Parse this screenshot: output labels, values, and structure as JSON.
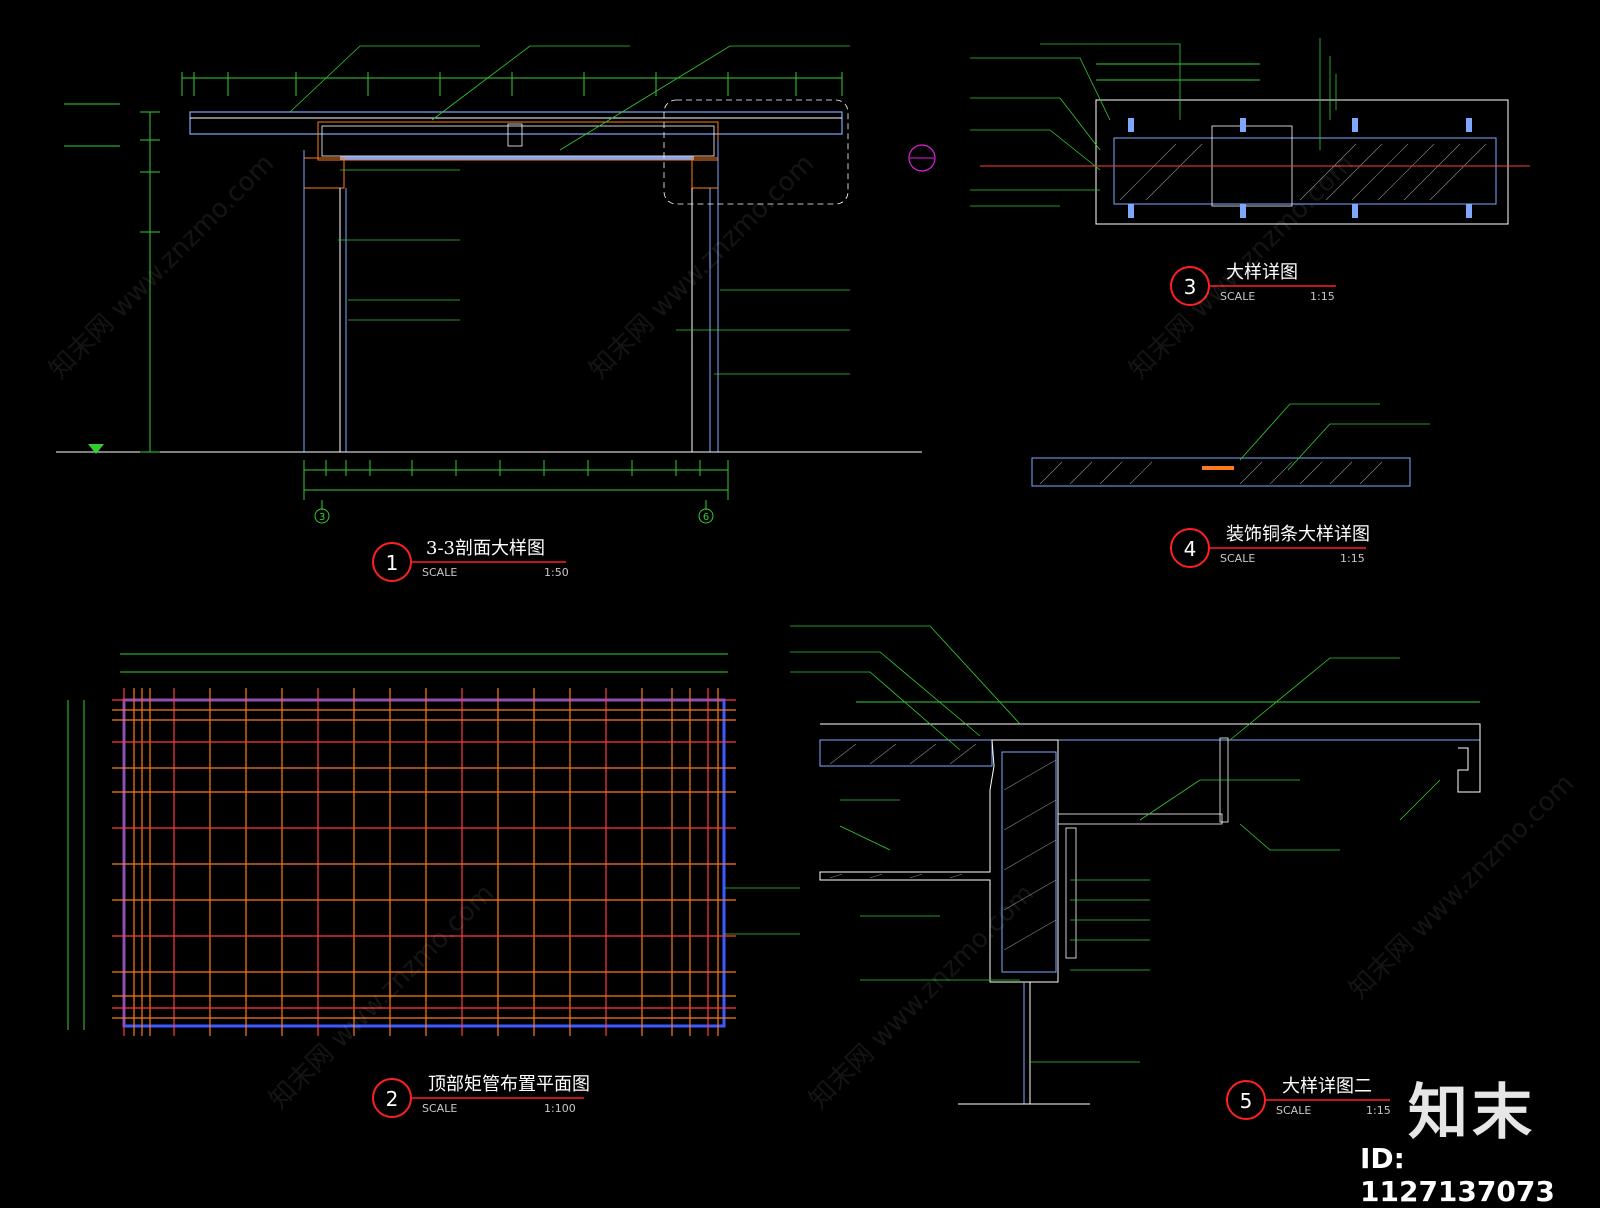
{
  "drawings": [
    {
      "number": "1",
      "title": "3-3剖面大样图",
      "scale_label": "SCALE",
      "scale": "1:50"
    },
    {
      "number": "2",
      "title": "顶部矩管布置平面图",
      "scale_label": "SCALE",
      "scale": "1:100"
    },
    {
      "number": "3",
      "title": "大样详图",
      "scale_label": "SCALE",
      "scale": "1:15"
    },
    {
      "number": "4",
      "title": "装饰铜条大样详图",
      "scale_label": "SCALE",
      "scale": "1:15"
    },
    {
      "number": "5",
      "title": "大样详图二",
      "scale_label": "SCALE",
      "scale": "1:15"
    }
  ],
  "axis_markers": [
    "3",
    "6"
  ],
  "watermark": {
    "brand": "知末",
    "id": "ID: 1127137073",
    "text": "知末网 www.znzmo.com"
  },
  "colors": {
    "background": "#000000",
    "outline": "#7fa7ff",
    "dimension": "#33cc33",
    "leader": "#33cc33",
    "grid_orange": "#ff7a1a",
    "grid_red": "#ff3b3b",
    "grid_border": "#3b5bff",
    "label_circle": "#ff2020",
    "text": "#ffffff",
    "marker_magenta": "#e020e0"
  },
  "icons": [
    "section-marker-circle",
    "level-marker-triangle"
  ]
}
